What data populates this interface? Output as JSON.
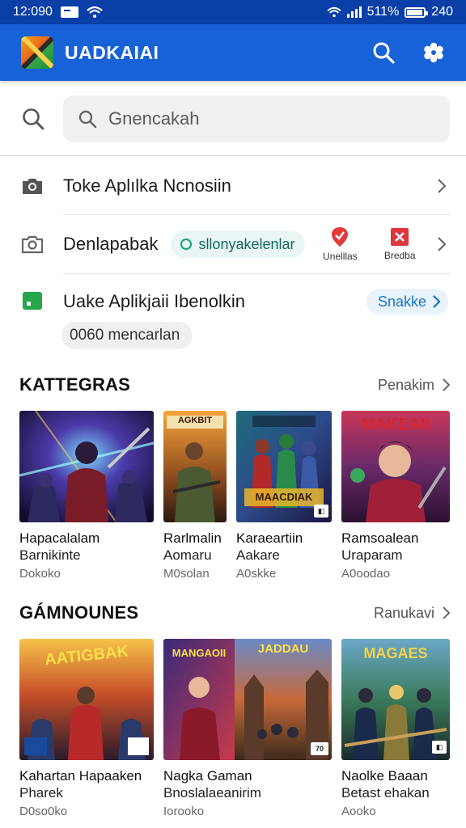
{
  "status_bar": {
    "time": "12:090",
    "battery_text": "240",
    "signal_text": "511%"
  },
  "app_bar": {
    "title": "UADKAIAI"
  },
  "search": {
    "placeholder": "Gnencakah"
  },
  "list": [
    {
      "label": "Toke Aplılka Ncnosiin"
    },
    {
      "label": "Denlapabak",
      "chip": "sllonyakelenlar",
      "apps": [
        "Unelllas",
        "Bredba"
      ]
    },
    {
      "label": "Uake Aplikjaii Ibenolkin",
      "button": "Snakke",
      "count_chip": "0060 mencarlan"
    }
  ],
  "section1": {
    "title": "KATTEGRAS",
    "more": "Penakim",
    "cards": [
      {
        "line1": "Hapacalalam",
        "line2": "Barnikinte",
        "line3": "Dokoko"
      },
      {
        "line1": "Rarlmalin",
        "line2": "Aomaru",
        "line3": "M0solan",
        "art_text": "AGKBIT"
      },
      {
        "line1": "Karaeartiin",
        "line2": "Aakare",
        "line3": "A0skke",
        "art_text": "MAACDIAK"
      },
      {
        "line1": "Ramsoalean",
        "line2": "Uraparam",
        "line3": "A0oodao",
        "art_text": "MAKEAII"
      }
    ]
  },
  "section2": {
    "title": "GÁMNOUNES",
    "more": "Ranukavi",
    "cards": [
      {
        "line1": "Kahartan Hapaaken",
        "line2": "Pharek",
        "line3": "D0so0ko",
        "art_text": "AATIGBAK"
      },
      {
        "line1": "Nagka Gaman",
        "line2": "Bnoslalaeanirim",
        "line3": "Iorooko",
        "art_text": "MANGAOII",
        "art_text2": "JADDAU"
      },
      {
        "line1": "Naolke Baaan",
        "line2": "Betast ehakan",
        "line3": "Aooko",
        "art_text": "MAGAES"
      }
    ]
  },
  "colors": {
    "status_bar": "#0a3fa8",
    "app_bar": "#1862d8",
    "chip_text": "#11695d",
    "link_blue": "#1674c8"
  }
}
